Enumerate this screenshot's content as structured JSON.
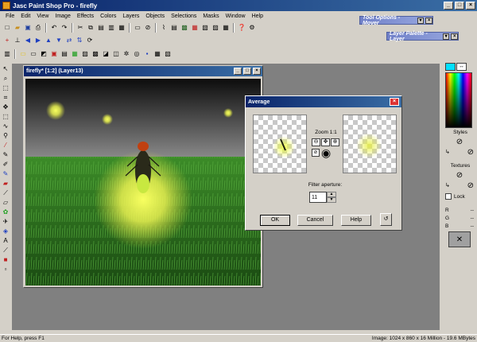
{
  "app": {
    "title": "Jasc Paint Shop Pro - firefly"
  },
  "menu": [
    "File",
    "Edit",
    "View",
    "Image",
    "Effects",
    "Colors",
    "Layers",
    "Objects",
    "Selections",
    "Masks",
    "Window",
    "Help"
  ],
  "floating": {
    "tool_options": "Tool Options - Mover",
    "layer_palette": "Layer Palette - Layer"
  },
  "image_window": {
    "title": "firefly* [1:2] (Layer13)"
  },
  "dialog": {
    "title": "Average",
    "zoom": "Zoom 1:1",
    "filter_label": "Filter aperture:",
    "filter_value": "11",
    "ok": "OK",
    "cancel": "Cancel",
    "help": "Help"
  },
  "panel": {
    "styles": "Styles",
    "textures": "Textures",
    "lock": "Lock",
    "r": "R",
    "g": "G",
    "b": "B",
    "dash": "--"
  },
  "status": {
    "help": "For Help, press F1",
    "image_info": "Image:  1024 x 860 x 16 Million - 19.6 MBytes"
  },
  "colors": {
    "title_start": "#0a246a",
    "title_end": "#3a6ea5",
    "workspace": "#808080"
  }
}
